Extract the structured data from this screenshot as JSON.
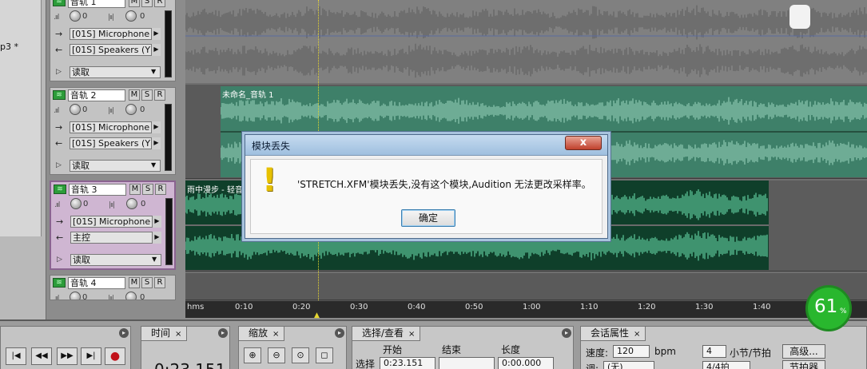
{
  "colors": {
    "wave": "#6fe7b4",
    "wave_bg": "#0f3f2a",
    "dialog_title": "#c5dbef",
    "badge": "#29b72e"
  },
  "file_panel": {
    "filename": "p3 *"
  },
  "tracks": [
    {
      "name": "音轨 1",
      "m": "M",
      "s": "S",
      "r": "R",
      "vol": "0",
      "pan": "0",
      "input": "[01S] Microphone",
      "output": "[01S] Speakers (Y",
      "mode": "读取"
    },
    {
      "name": "音轨 2",
      "m": "M",
      "s": "S",
      "r": "R",
      "vol": "0",
      "pan": "0",
      "input": "[01S] Microphone",
      "output": "[01S] Speakers (Y",
      "mode": "读取"
    },
    {
      "name": "音轨 3",
      "m": "M",
      "s": "S",
      "r": "R",
      "vol": "0",
      "pan": "0",
      "input": "[01S] Microphone",
      "output": "主控",
      "mode": "读取"
    },
    {
      "name": "音轨 4",
      "m": "M",
      "s": "S",
      "r": "R",
      "vol": "0",
      "pan": "0"
    }
  ],
  "clips": {
    "track2": "未命名_音轨 1",
    "track3": "雨中漫步 - 轻音"
  },
  "ruler": {
    "ticks": [
      "hms",
      "0:10",
      "0:20",
      "0:30",
      "0:40",
      "0:50",
      "1:00",
      "1:10",
      "1:20",
      "1:30",
      "1:40"
    ]
  },
  "dialog": {
    "title": "模块丢失",
    "close": "x",
    "message": "'STRETCH.XFM'模块丢失,没有这个模块,Audition 无法更改采样率。",
    "ok": "确定"
  },
  "badge": {
    "value": "61",
    "unit": "%"
  },
  "panels": {
    "time": {
      "tab": "时间",
      "value": "0:23.151"
    },
    "zoom": {
      "tab": "缩放"
    },
    "selection": {
      "tab": "选择/查看",
      "col_start": "开始",
      "col_end": "结束",
      "col_length": "长度",
      "row_label": "选择",
      "start": "0:23.151",
      "end": "",
      "length": "0:00.000"
    },
    "session": {
      "tab": "会话属性",
      "speed_label": "速度:",
      "speed": "120",
      "bpm": "bpm",
      "beats": "4",
      "beats_label": "小节/节拍",
      "advanced": "高级...",
      "key_label": "调:",
      "key": "(无)",
      "time_sig": "4/4拍",
      "metronome": "节拍器"
    },
    "close": "×"
  }
}
